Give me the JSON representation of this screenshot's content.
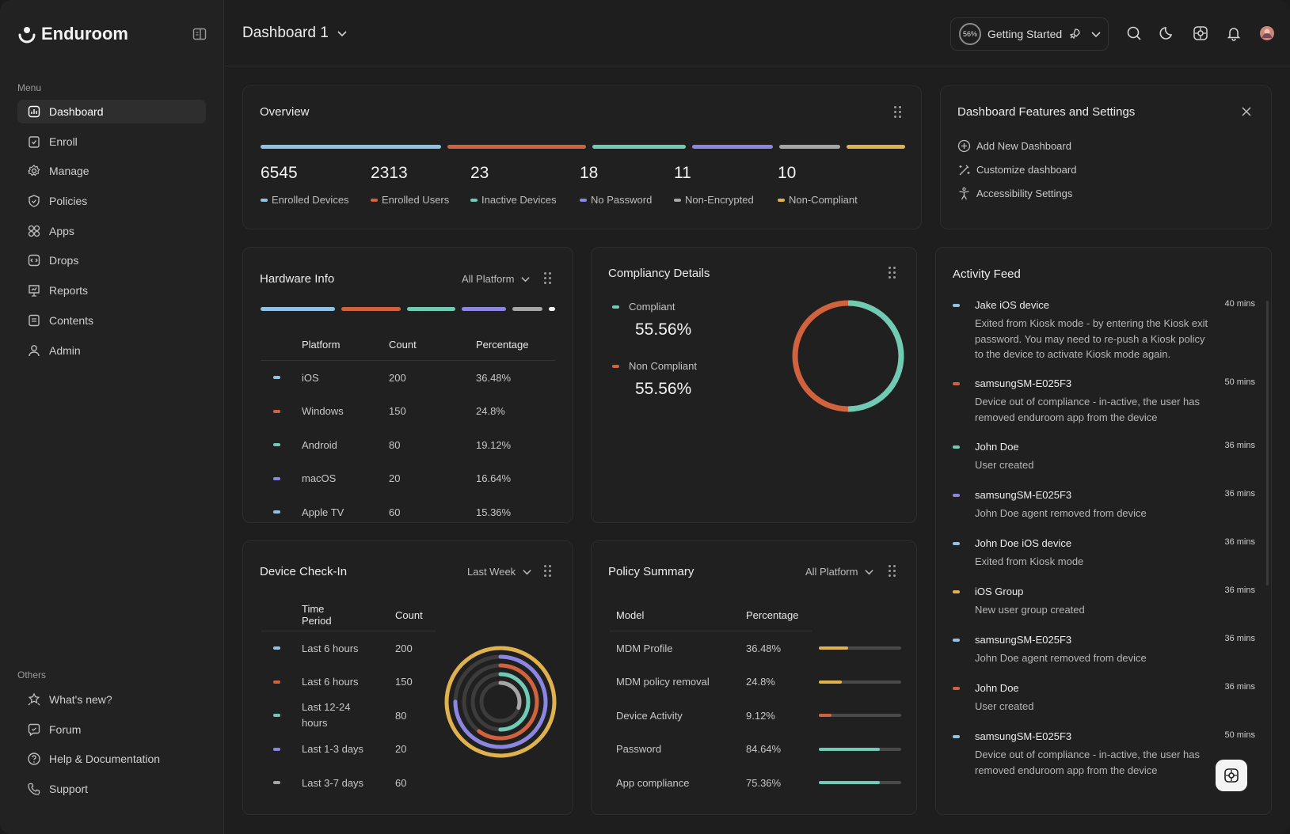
{
  "app": {
    "name": "Enduroom"
  },
  "sidebar": {
    "menu_label": "Menu",
    "items": [
      {
        "label": "Dashboard",
        "icon": "chart-icon"
      },
      {
        "label": "Enroll",
        "icon": "clipboard-icon"
      },
      {
        "label": "Manage",
        "icon": "gear-icon"
      },
      {
        "label": "Policies",
        "icon": "shield-icon"
      },
      {
        "label": "Apps",
        "icon": "apps-grid-icon"
      },
      {
        "label": "Drops",
        "icon": "code-file-icon"
      },
      {
        "label": "Reports",
        "icon": "report-icon"
      },
      {
        "label": "Contents",
        "icon": "document-icon"
      },
      {
        "label": "Admin",
        "icon": "user-icon"
      }
    ],
    "others_label": "Others",
    "others": [
      {
        "label": "What's new?",
        "icon": "badge-star-icon"
      },
      {
        "label": "Forum",
        "icon": "forum-icon"
      },
      {
        "label": "Help & Documentation",
        "icon": "help-icon"
      },
      {
        "label": "Support",
        "icon": "phone-icon"
      }
    ]
  },
  "header": {
    "title": "Dashboard 1",
    "getting_started": {
      "label": "Getting Started",
      "progress": "56%"
    }
  },
  "colors": {
    "blue": "#8fc3e6",
    "orange": "#d0623e",
    "teal": "#6fcbb4",
    "purple": "#8b86e0",
    "gray": "#a6a6a6",
    "yellow": "#e0b24e"
  },
  "overview": {
    "title": "Overview",
    "stats": [
      {
        "value": "6545",
        "label": "Enrolled Devices",
        "color": "#8fc3e6"
      },
      {
        "value": "2313",
        "label": "Enrolled Users",
        "color": "#d0623e"
      },
      {
        "value": "23",
        "label": "Inactive Devices",
        "color": "#6fcbb4"
      },
      {
        "value": "18",
        "label": "No Password",
        "color": "#8b86e0"
      },
      {
        "value": "11",
        "label": "Non-Encrypted",
        "color": "#a6a6a6"
      },
      {
        "value": "10",
        "label": "Non-Compliant",
        "color": "#e0b24e"
      }
    ]
  },
  "features": {
    "title": "Dashboard Features and Settings",
    "items": [
      {
        "label": "Add New Dashboard",
        "icon": "plus-circle-icon"
      },
      {
        "label": "Customize dashboard",
        "icon": "magic-wand-icon"
      },
      {
        "label": "Accessibility Settings",
        "icon": "accessibility-icon"
      }
    ]
  },
  "hardware": {
    "title": "Hardware Info",
    "filter": "All Platform",
    "columns": [
      "Platform",
      "Count",
      "Percentage"
    ],
    "rows": [
      {
        "platform": "iOS",
        "count": "200",
        "pct": "36.48%",
        "color": "#8fc3e6"
      },
      {
        "platform": "Windows",
        "count": "150",
        "pct": "24.8%",
        "color": "#d0623e"
      },
      {
        "platform": "Android",
        "count": "80",
        "pct": "19.12%",
        "color": "#6fcbb4"
      },
      {
        "platform": "macOS",
        "count": "20",
        "pct": "16.64%",
        "color": "#8b86e0"
      },
      {
        "platform": "Apple TV",
        "count": "60",
        "pct": "15.36%",
        "color": "#8fc3e6"
      }
    ]
  },
  "compliancy": {
    "title": "Compliancy Details",
    "items": [
      {
        "label": "Compliant",
        "value": "55.56%",
        "color": "#6fcbb4"
      },
      {
        "label": "Non Compliant",
        "value": "55.56%",
        "color": "#d0623e"
      }
    ],
    "compliant_fraction": 0.5
  },
  "activity": {
    "title": "Activity Feed",
    "items": [
      {
        "title": "Jake iOS device",
        "time": "40 mins",
        "desc": "Exited from Kiosk mode -  by entering the Kiosk exit password. You may need to re-push a Kiosk policy to the device to activate Kiosk mode again.",
        "color": "#8fc3e6"
      },
      {
        "title": "samsungSM-E025F3",
        "time": "50 mins",
        "desc": "Device out of compliance - in-active, the user has removed enduroom app from the device",
        "color": "#d0623e"
      },
      {
        "title": "John Doe",
        "time": "36 mins",
        "desc": "User created",
        "color": "#6fcbb4"
      },
      {
        "title": "samsungSM-E025F3",
        "time": "36 mins",
        "desc": "John Doe agent removed from device",
        "color": "#8b86e0"
      },
      {
        "title": "John Doe iOS device",
        "time": "36 mins",
        "desc": "Exited from Kiosk mode",
        "color": "#8fc3e6"
      },
      {
        "title": "iOS Group",
        "time": "36 mins",
        "desc": "New user group created",
        "color": "#e0b24e"
      },
      {
        "title": "samsungSM-E025F3",
        "time": "36 mins",
        "desc": "John Doe agent removed from device",
        "color": "#8fc3e6"
      },
      {
        "title": "John Doe",
        "time": "36 mins",
        "desc": "User created",
        "color": "#d0623e"
      },
      {
        "title": "samsungSM-E025F3",
        "time": "50 mins",
        "desc": "Device out of compliance - in-active, the user has removed enduroom app from the device",
        "color": "#8fc3e6"
      }
    ]
  },
  "checkin": {
    "title": "Device Check-In",
    "filter": "Last Week",
    "columns": [
      "Time Period",
      "Count"
    ],
    "rows": [
      {
        "period": "Last 6 hours",
        "count": "200",
        "color": "#8fc3e6"
      },
      {
        "period": "Last 6 hours",
        "count": "150",
        "color": "#d0623e"
      },
      {
        "period": "Last 12-24 hours",
        "count": "80",
        "color": "#6fcbb4"
      },
      {
        "period": "Last 1-3 days",
        "count": "20",
        "color": "#8b86e0"
      },
      {
        "period": "Last 3-7 days",
        "count": "60",
        "color": "#a6a6a6"
      }
    ],
    "rings": [
      {
        "color": "#e0b24e",
        "fraction": 1.0
      },
      {
        "color": "#8b86e0",
        "fraction": 0.75
      },
      {
        "color": "#d0623e",
        "fraction": 0.6
      },
      {
        "color": "#6fcbb4",
        "fraction": 0.5
      },
      {
        "color": "#a6a6a6",
        "fraction": 0.3
      }
    ]
  },
  "policy": {
    "title": "Policy Summary",
    "filter": "All Platform",
    "columns": [
      "Model",
      "Percentage"
    ],
    "rows": [
      {
        "model": "MDM Profile",
        "pct": "36.48%",
        "fraction": 0.36,
        "color": "#e0b24e"
      },
      {
        "model": "MDM policy removal",
        "pct": "24.8%",
        "fraction": 0.28,
        "color": "#e0b24e"
      },
      {
        "model": "Device Activity",
        "pct": "9.12%",
        "fraction": 0.15,
        "color": "#d0623e"
      },
      {
        "model": "Password",
        "pct": "84.64%",
        "fraction": 0.74,
        "color": "#6fcbb4"
      },
      {
        "model": "App compliance",
        "pct": "75.36%",
        "fraction": 0.74,
        "color": "#6fcbb4"
      }
    ]
  }
}
